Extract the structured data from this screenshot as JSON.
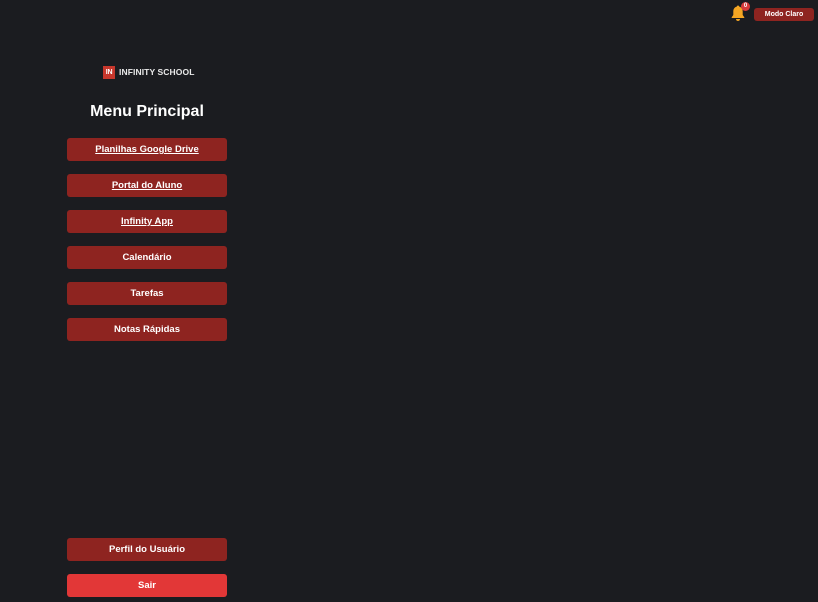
{
  "header": {
    "notification_count": "0",
    "theme_toggle_label": "Modo Claro"
  },
  "logo": {
    "mark": "IN",
    "text": "INFINITY SCHOOL"
  },
  "menu": {
    "title": "Menu Principal",
    "items": [
      {
        "label": "Planilhas Google Drive",
        "link": true
      },
      {
        "label": "Portal do Aluno",
        "link": true
      },
      {
        "label": "Infinity App",
        "link": true
      },
      {
        "label": "Calendário",
        "link": false
      },
      {
        "label": "Tarefas",
        "link": false
      },
      {
        "label": "Notas Rápidas",
        "link": false
      }
    ]
  },
  "footer": {
    "profile_label": "Perfil do Usuário",
    "logout_label": "Sair"
  },
  "colors": {
    "background": "#1b1c20",
    "button": "#8e2420",
    "logout_button": "#e23737",
    "bell": "#f5a623",
    "logo_mark": "#c8372c"
  }
}
